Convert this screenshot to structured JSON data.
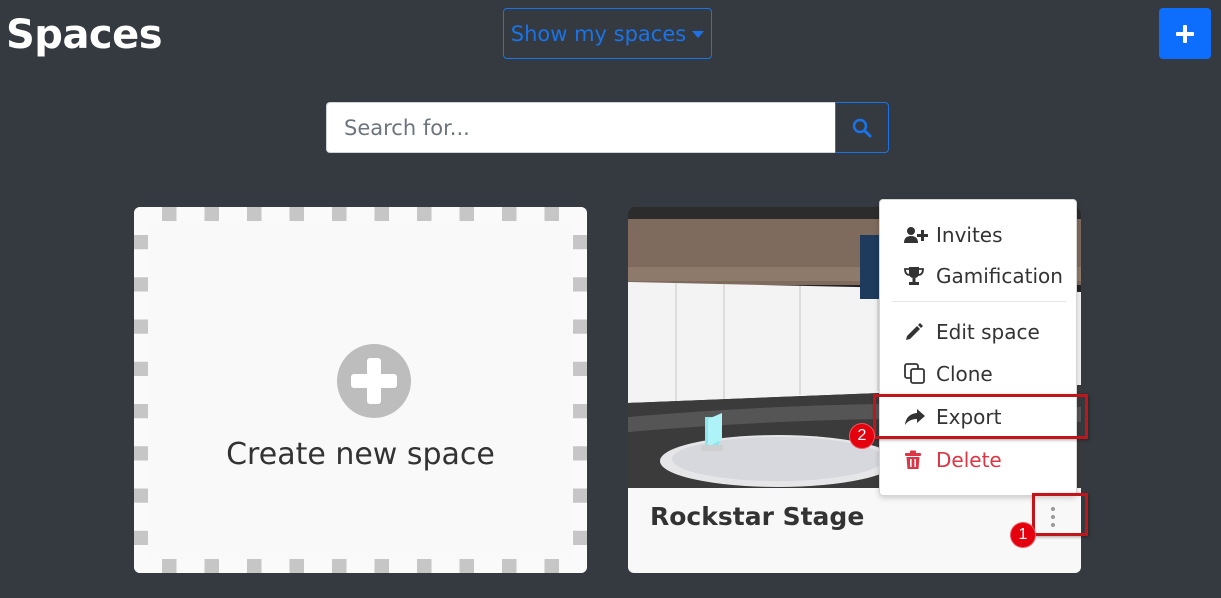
{
  "header": {
    "title": "Spaces",
    "filter_label": "Show my spaces",
    "add_icon": "plus-icon"
  },
  "search": {
    "placeholder": "Search for...",
    "value": "",
    "icon": "search-icon"
  },
  "create_card": {
    "label": "Create new space",
    "icon": "plus-circle-icon"
  },
  "space_card": {
    "name": "Rockstar Stage",
    "menu_icon": "kebab-vertical-icon"
  },
  "context_menu": {
    "items": [
      {
        "label": "Invites",
        "icon": "user-plus-icon"
      },
      {
        "label": "Gamification",
        "icon": "trophy-icon"
      },
      {
        "label": "Edit space",
        "icon": "pencil-icon"
      },
      {
        "label": "Clone",
        "icon": "copy-icon"
      },
      {
        "label": "Export",
        "icon": "share-arrow-icon"
      },
      {
        "label": "Delete",
        "icon": "trash-icon"
      }
    ]
  },
  "annotations": {
    "step1": "1",
    "step2": "2"
  },
  "colors": {
    "background": "#343a40",
    "primary": "#0d6efd",
    "link": "#1a73e8",
    "danger": "#dc3545",
    "highlight": "#c0151b"
  }
}
